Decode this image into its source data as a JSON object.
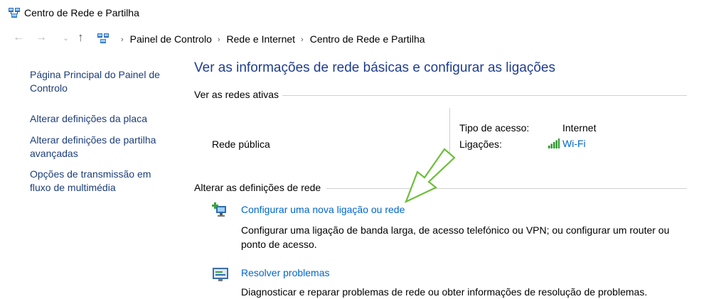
{
  "window": {
    "title": "Centro de Rede e Partilha",
    "icon": "network-sharing-icon"
  },
  "address": {
    "back_icon": "←",
    "forward_icon": "→",
    "history_icon": "⌄",
    "up_icon": "↑",
    "crumbs": [
      "Painel de Controlo",
      "Rede e Internet",
      "Centro de Rede e Partilha"
    ],
    "separator": "›"
  },
  "sidebar": {
    "items": [
      {
        "label": "Página Principal do Painel de Controlo"
      },
      {
        "label": "Alterar definições da placa"
      },
      {
        "label": "Alterar definições de partilha avançadas"
      },
      {
        "label": "Opções de transmissão em fluxo de multimédia"
      }
    ]
  },
  "main": {
    "title": "Ver as informações de rede básicas e configurar as ligações",
    "active_networks": {
      "heading": "Ver as redes ativas",
      "network_name": "Rede pública",
      "access_type_label": "Tipo de acesso:",
      "access_type_value": "Internet",
      "connections_label": "Ligações:",
      "connections_value": "Wi-Fi"
    },
    "change_settings": {
      "heading": "Alterar as definições de rede",
      "tasks": [
        {
          "link": "Configurar uma nova ligação ou rede",
          "description": "Configurar uma ligação de banda larga, de acesso telefónico ou VPN; ou configurar um router ou ponto de acesso."
        },
        {
          "link": "Resolver problemas",
          "description": "Diagnosticar e reparar problemas de rede ou obter informações de resolução de problemas."
        }
      ]
    }
  },
  "colors": {
    "title_blue": "#1e3d8f",
    "link_blue": "#0066cc",
    "sidebar_link": "#1c3d7a",
    "annotation_arrow": "#6cbf3a"
  }
}
